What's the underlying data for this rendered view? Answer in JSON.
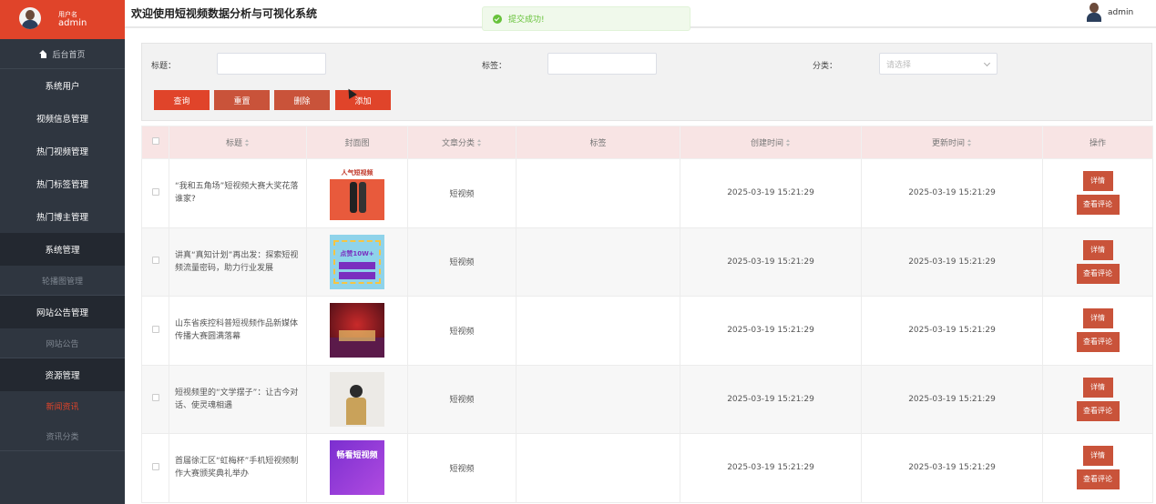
{
  "sidebar": {
    "user_label": "用户名",
    "username": "admin",
    "home": "后台首页",
    "items": [
      {
        "label": "系统用户",
        "type": "item"
      },
      {
        "label": "视频信息管理",
        "type": "item"
      },
      {
        "label": "热门视频管理",
        "type": "item"
      },
      {
        "label": "热门标签管理",
        "type": "item"
      },
      {
        "label": "热门博主管理",
        "type": "item"
      },
      {
        "label": "系统管理",
        "type": "group"
      },
      {
        "label": "轮播图管理",
        "type": "sub"
      },
      {
        "label": "网站公告管理",
        "type": "group"
      },
      {
        "label": "网站公告",
        "type": "sub"
      },
      {
        "label": "资源管理",
        "type": "group"
      },
      {
        "label": "新闻资讯",
        "type": "sub-active"
      },
      {
        "label": "资讯分类",
        "type": "sub"
      }
    ]
  },
  "header": {
    "title": "欢迎使用短视频数据分析与可视化系统",
    "username": "admin"
  },
  "toast": {
    "message": "提交成功!",
    "color": "#67c23a"
  },
  "search": {
    "title_label": "标题：",
    "title_value": "",
    "tag_label": "标签：",
    "tag_value": "",
    "category_label": "分类：",
    "category_placeholder": "请选择",
    "buttons": {
      "query": "查询",
      "reset": "重置",
      "delete": "删除",
      "add": "添加"
    }
  },
  "table": {
    "columns": {
      "title": "标题",
      "cover": "封面图",
      "category": "文章分类",
      "tags": "标签",
      "created": "创建时间",
      "updated": "更新时间",
      "actions": "操作"
    },
    "actions": {
      "detail": "详情",
      "comments": "查看评论"
    },
    "rows": [
      {
        "title": "“我和五角场”短视频大赛大奖花落谁家?",
        "category": "短视频",
        "tags": "",
        "created": "2025-03-19 15:21:29",
        "updated": "2025-03-19 15:21:29",
        "thumb_text": "人气短视频"
      },
      {
        "title": "讲真“真知计划”再出发：探索短视频流量密码，助力行业发展",
        "category": "短视频",
        "tags": "",
        "created": "2025-03-19 15:21:29",
        "updated": "2025-03-19 15:21:29",
        "thumb_text": "点赞10W+"
      },
      {
        "title": "山东省疾控科普短视频作品新媒体传播大赛圆满落幕",
        "category": "短视频",
        "tags": "",
        "created": "2025-03-19 15:21:29",
        "updated": "2025-03-19 15:21:29",
        "thumb_text": ""
      },
      {
        "title": "短视频里的“文学摆子”：让古今对话、使灵魂相遇",
        "category": "短视频",
        "tags": "",
        "created": "2025-03-19 15:21:29",
        "updated": "2025-03-19 15:21:29",
        "thumb_text": ""
      },
      {
        "title": "首届徐汇区“虹梅杯”手机短视频制作大赛颁奖典礼举办",
        "category": "短视频",
        "tags": "",
        "created": "2025-03-19 15:21:29",
        "updated": "2025-03-19 15:21:29",
        "thumb_text": "畅看短视频"
      }
    ]
  },
  "colors": {
    "accent": "#e0442a",
    "sidebar_bg": "#2f3640",
    "header_row_bg": "#f8e4e4"
  }
}
